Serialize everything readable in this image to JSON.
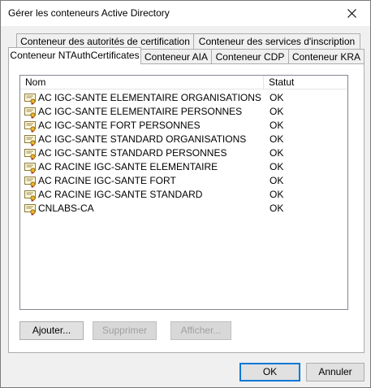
{
  "window": {
    "title": "Gérer les conteneurs Active Directory"
  },
  "tabs": {
    "row1": [
      {
        "label": "Conteneur des autorités de certification"
      },
      {
        "label": "Conteneur des services d'inscription"
      }
    ],
    "row2": [
      {
        "label": "Conteneur NTAuthCertificates",
        "active": true
      },
      {
        "label": "Conteneur AIA"
      },
      {
        "label": "Conteneur CDP"
      },
      {
        "label": "Conteneur KRA"
      }
    ]
  },
  "list": {
    "columns": {
      "name": "Nom",
      "status": "Statut"
    },
    "rows": [
      {
        "name": "AC IGC-SANTE ELEMENTAIRE ORGANISATIONS",
        "status": "OK"
      },
      {
        "name": "AC IGC-SANTE ELEMENTAIRE PERSONNES",
        "status": "OK"
      },
      {
        "name": "AC IGC-SANTE FORT PERSONNES",
        "status": "OK"
      },
      {
        "name": "AC IGC-SANTE STANDARD ORGANISATIONS",
        "status": "OK"
      },
      {
        "name": "AC IGC-SANTE STANDARD PERSONNES",
        "status": "OK"
      },
      {
        "name": "AC RACINE IGC-SANTE ELEMENTAIRE",
        "status": "OK"
      },
      {
        "name": "AC RACINE IGC-SANTE FORT",
        "status": "OK"
      },
      {
        "name": "AC RACINE IGC-SANTE STANDARD",
        "status": "OK"
      },
      {
        "name": "CNLABS-CA",
        "status": "OK"
      }
    ],
    "row_icon": "certificate-icon"
  },
  "panel_buttons": {
    "add": "Ajouter...",
    "remove": "Supprimer",
    "view": "Afficher..."
  },
  "dialog_buttons": {
    "ok": "OK",
    "cancel": "Annuler"
  }
}
